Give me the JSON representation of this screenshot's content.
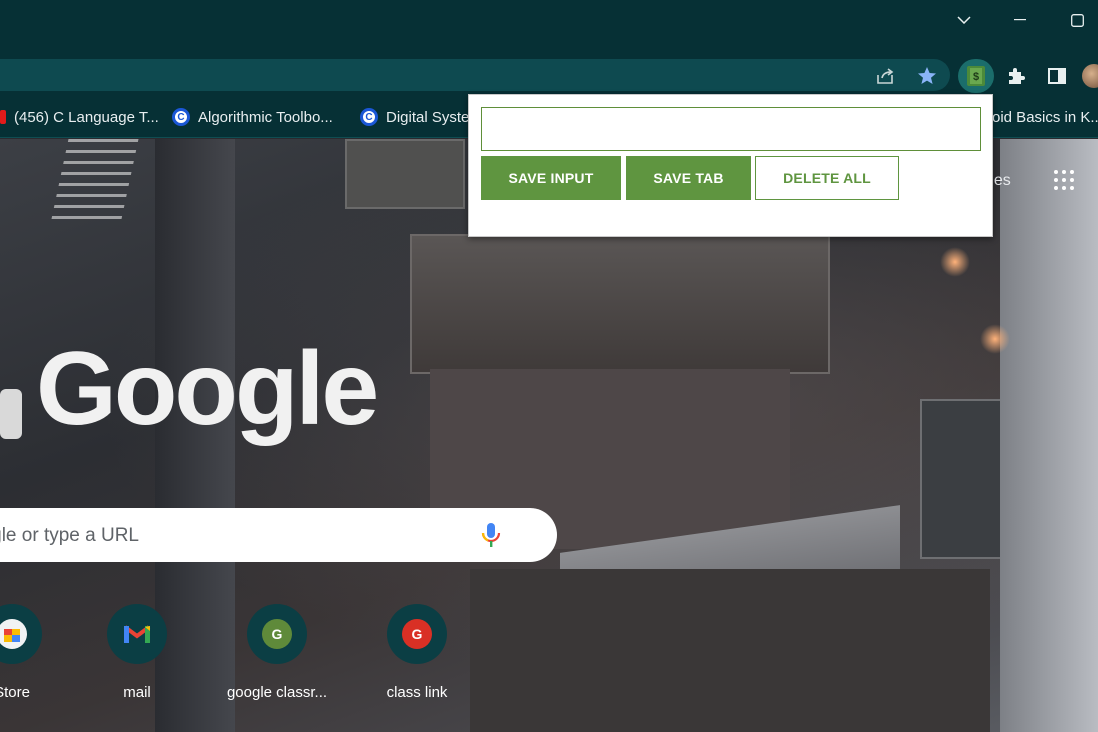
{
  "titlebar": {
    "controls": [
      "tab-list",
      "minimize",
      "maximize"
    ]
  },
  "toolbar": {
    "icons": [
      "share-icon",
      "star-icon",
      "extension-icon",
      "puzzle-icon",
      "side-panel-icon",
      "avatar"
    ]
  },
  "bookmarks": [
    {
      "label": "(456) C Language T...",
      "icon": "youtube-favicon"
    },
    {
      "label": "Algorithmic Toolbo...",
      "icon": "coursera-favicon"
    },
    {
      "label": "Digital Syste",
      "icon": "coursera-favicon"
    },
    {
      "label": "oid Basics in K...",
      "icon": ""
    }
  ],
  "ntp": {
    "logo": "Google",
    "search_placeholder": "oogle or type a URL",
    "images_link": "ges",
    "shortcuts": [
      {
        "label": "Store",
        "icon": "store-favicon"
      },
      {
        "label": "mail",
        "icon": "gmail-favicon"
      },
      {
        "label": "google classr...",
        "icon": "G",
        "color": "#5f8a3a"
      },
      {
        "label": "class link",
        "icon": "G",
        "color": "#d93025"
      }
    ]
  },
  "popup": {
    "input_value": "",
    "save_input_label": "SAVE INPUT",
    "save_tab_label": "SAVE TAB",
    "delete_all_label": "DELETE ALL",
    "accent": "#5f9540"
  }
}
